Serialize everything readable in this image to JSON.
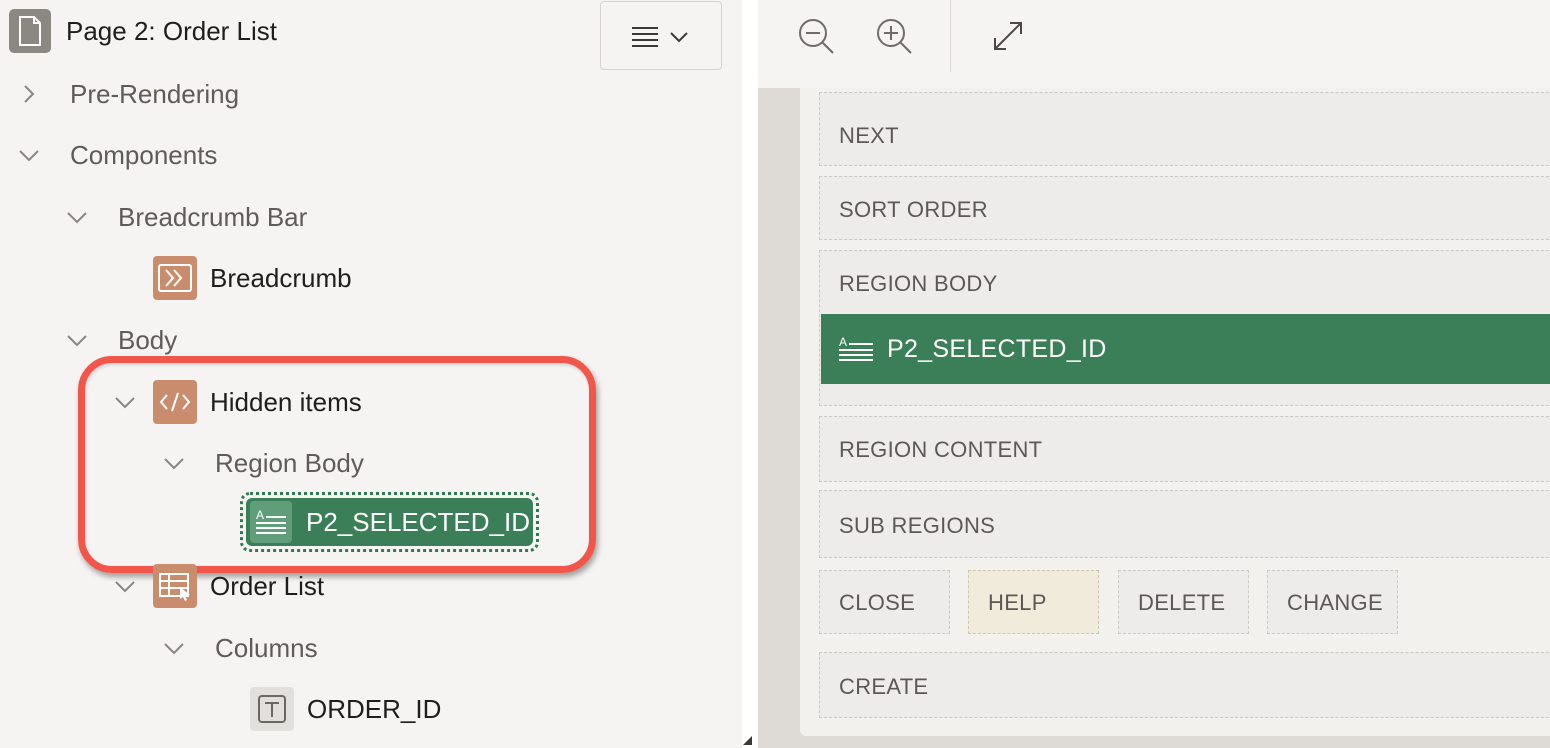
{
  "tree": {
    "page_title": "Page 2: Order List",
    "pre_rendering": "Pre-Rendering",
    "components": "Components",
    "breadcrumb_bar": "Breadcrumb Bar",
    "breadcrumb": "Breadcrumb",
    "body": "Body",
    "hidden_items": "Hidden items",
    "region_body": "Region Body",
    "selected_item": "P2_SELECTED_ID",
    "order_list": "Order List",
    "columns": "Columns",
    "order_id": "ORDER_ID"
  },
  "layout": {
    "slots": {
      "next": "NEXT",
      "sort_order": "SORT ORDER",
      "region_body": "REGION BODY",
      "region_content": "REGION CONTENT",
      "sub_regions": "SUB REGIONS",
      "close": "CLOSE",
      "help": "HELP",
      "delete": "DELETE",
      "change": "CHANGE",
      "create": "CREATE"
    },
    "item_label": "P2_SELECTED_ID"
  },
  "icons": {
    "zoom_out": "zoom-out-icon",
    "zoom_in": "zoom-in-icon",
    "expand": "expand-icon",
    "menu": "menu-icon"
  },
  "colors": {
    "selected_green": "#3b7f58",
    "highlight_red": "#f0564a",
    "component_orange": "#c98d6e",
    "help_slot": "#f1ebdb"
  }
}
